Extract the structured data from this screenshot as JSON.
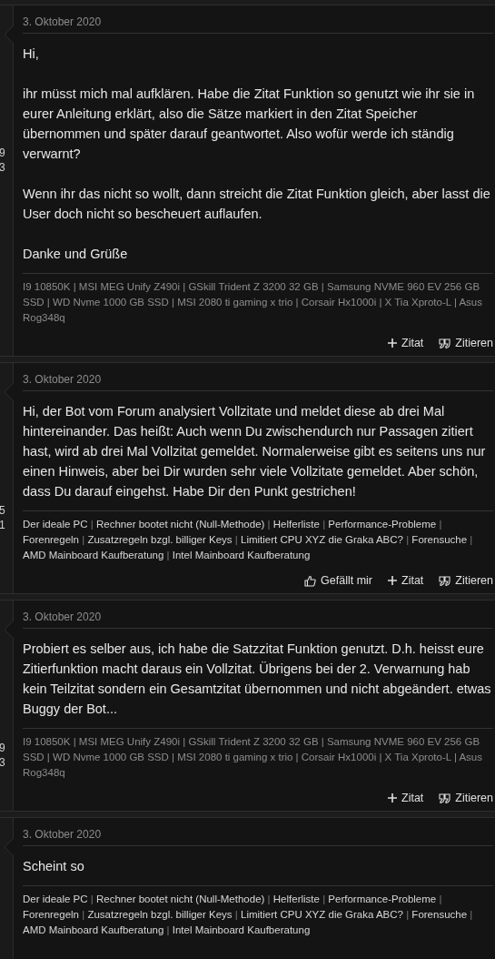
{
  "posts": [
    {
      "date": "3. Oktober 2020",
      "side_numbers": [
        "9",
        "3"
      ],
      "paragraphs": [
        "Hi,",
        "ihr müsst mich mal aufklären. Habe die Zitat Funktion so genutzt wie ihr sie in eurer Anleitung erklärt, also die Sätze markiert in den Zitat Speicher übernommen und später darauf geantwortet. Also wofür werde ich ständig verwarnt?",
        "Wenn ihr das nicht so wollt, dann streicht die Zitat Funktion gleich, aber lasst die User doch nicht so bescheuert auflaufen.",
        "Danke und Grüße"
      ],
      "signature": {
        "kind": "text",
        "text": "I9 10850K | MSI MEG Unify Z490i | GSkill Trident Z 3200 32 GB | Samsung NVME 960 EV 256 GB SSD | WD Nvme 1000 GB SSD | MSI 2080 ti gaming x trio | Corsair Hx1000i | X Tia Xproto-L | Asus Rog348q"
      },
      "actions": [
        {
          "kind": "plus",
          "label": "Zitat"
        },
        {
          "kind": "quote",
          "label": "Zitieren"
        }
      ]
    },
    {
      "date": "3. Oktober 2020",
      "side_numbers": [
        "5",
        "1"
      ],
      "paragraphs": [
        "Hi, der Bot vom Forum analysiert Vollzitate und meldet diese ab drei Mal hintereinander. Das heißt: Auch wenn Du zwischendurch nur Passagen zitiert hast, wird ab drei Mal Vollzitat gemeldet. Normalerweise gibt es seitens uns nur einen Hinweis, aber bei Dir wurden sehr viele Vollzitate gemeldet. Aber schön, dass Du darauf eingehst. Habe Dir den Punkt gestrichen!"
      ],
      "signature": {
        "kind": "links",
        "links": [
          "Der ideale PC",
          "Rechner bootet nicht (Null-Methode)",
          "Helferliste",
          "Performance-Probleme",
          "Forenregeln",
          "Zusatzregeln bzgl. billiger Keys",
          "Limitiert CPU XYZ die Graka ABC?",
          "Forensuche",
          "AMD Mainboard Kaufberatung",
          "Intel Mainboard Kaufberatung"
        ],
        "separator": "|"
      },
      "actions": [
        {
          "kind": "like",
          "label": "Gefällt mir"
        },
        {
          "kind": "plus",
          "label": "Zitat"
        },
        {
          "kind": "quote",
          "label": "Zitieren"
        }
      ]
    },
    {
      "date": "3. Oktober 2020",
      "side_numbers": [
        "9",
        "3"
      ],
      "paragraphs": [
        "Probiert es selber aus, ich habe die Satzzitat Funktion genutzt. D.h. heisst eure Zitierfunktion macht daraus ein Vollzitat. Übrigens bei der 2. Verwarnung hab kein Teilzitat sondern ein Gesamtzitat übernommen und nicht abgeändert. etwas Buggy der Bot..."
      ],
      "signature": {
        "kind": "text",
        "text": "I9 10850K | MSI MEG Unify Z490i | GSkill Trident Z 3200 32 GB | Samsung NVME 960 EV 256 GB SSD | WD Nvme 1000 GB SSD | MSI 2080 ti gaming x trio | Corsair Hx1000i | X Tia Xproto-L | Asus Rog348q"
      },
      "actions": [
        {
          "kind": "plus",
          "label": "Zitat"
        },
        {
          "kind": "quote",
          "label": "Zitieren"
        }
      ]
    },
    {
      "date": "3. Oktober 2020",
      "paragraphs": [
        "Scheint so"
      ],
      "signature": {
        "kind": "links",
        "links": [
          "Der ideale PC",
          "Rechner bootet nicht (Null-Methode)",
          "Helferliste",
          "Performance-Probleme",
          "Forenregeln",
          "Zusatzregeln bzgl. billiger Keys",
          "Limitiert CPU XYZ die Graka ABC?",
          "Forensuche",
          "AMD Mainboard Kaufberatung",
          "Intel Mainboard Kaufberatung"
        ],
        "separator": "|"
      }
    }
  ]
}
